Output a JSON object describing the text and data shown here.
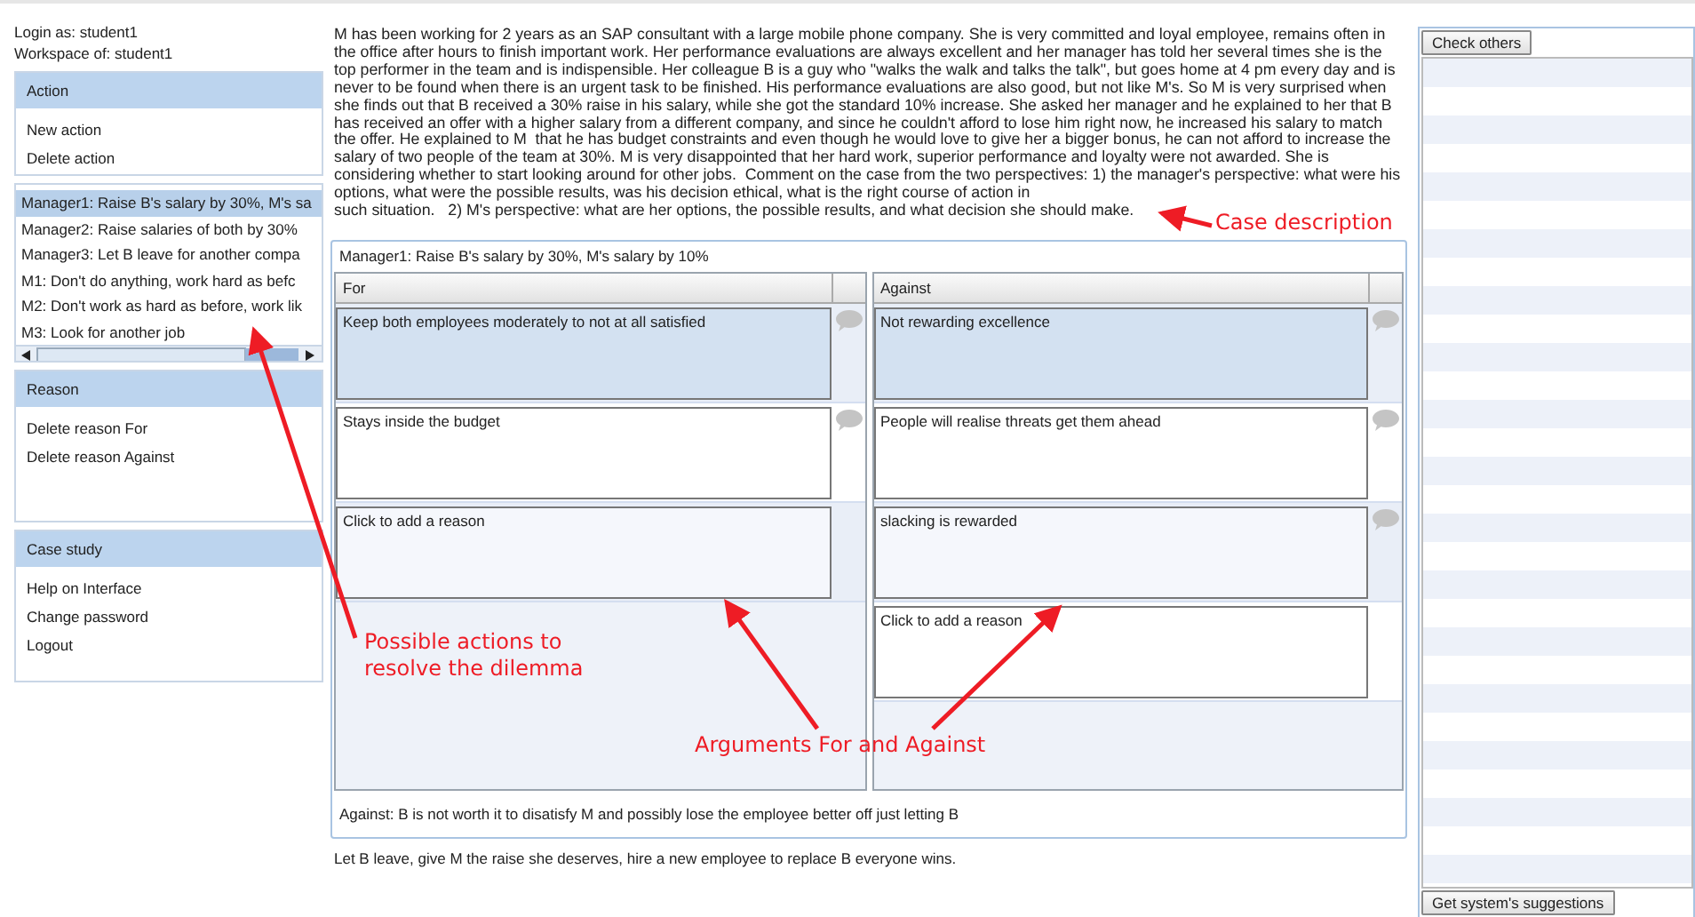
{
  "login": {
    "user_line": "Login as: student1",
    "workspace_line": "Workspace of: student1"
  },
  "panels": [
    {
      "title": "Action",
      "links": [
        "New action",
        "Delete action"
      ]
    },
    {
      "title": "Reason",
      "links": [
        "Delete reason For",
        "Delete reason Against"
      ]
    },
    {
      "title": "Case study",
      "links": [
        "Help on Interface",
        "Change password",
        "Logout"
      ]
    }
  ],
  "actions": [
    {
      "label": "Manager1: Raise B's salary by 30%, M's sa",
      "selected": true
    },
    {
      "label": "Manager2: Raise salaries of both by 30%",
      "selected": false
    },
    {
      "label": "Manager3: Let B leave for another compa",
      "selected": false
    },
    {
      "label": "M1: Don't do anything, work hard as befc",
      "selected": false
    },
    {
      "label": "M2: Don't work as hard as before, work lik",
      "selected": false
    },
    {
      "label": "M3: Look for another job",
      "selected": false
    }
  ],
  "case_description": [
    "M has been working for 2 years as an SAP consultant with a large mobile phone company. She is very committed and loyal employee, remains often in the office after hours to finish important work. Her performance evaluations are always excellent and her manager has told her several times she is the top performer in the team and is indispensible. Her colleague B is a guy who \"walks the walk and talks the talk\", but goes home at 4 pm every day and is never to be found when there is an urgent task to be finished. His performance evaluations are also good, but not like M's. So M is very surprised when she finds out that B received a 30% raise in his salary, while she got the standard 10% increase. She asked her manager and he explained to her that B has received an offer with a higher salary from a different company, and since he couldn't afford to lose him right now, he increased his salary to match the offer. He explained to M  that he has budget constraints and even though he would love to give her a bigger bonus, he can not afford to increase the salary of two people of the team at 30%. M is very disappointed that her hard work, superior performance and loyalty were not awarded. She is considering whether to start looking around for other jobs.  Comment on the case from the two perspectives: 1) the manager's perspective: what were his options, what were the possible results, was his decision ethical, what is the right course of action in",
    "such situation.   2) M's perspective: what are her options, the possible results, and what decision she should make."
  ],
  "action_detail": {
    "title": "Manager1: Raise B's salary by 30%, M's salary by 10%",
    "columns": [
      {
        "heading": "For",
        "reasons": [
          {
            "kind": "reason",
            "text": "Keep both employees moderately to not at all satisfied",
            "selected": true
          },
          {
            "kind": "reason",
            "text": "Stays inside the budget",
            "selected": false
          },
          {
            "kind": "placeholder",
            "text": "Click to add a reason",
            "selected": false
          }
        ]
      },
      {
        "heading": "Against",
        "reasons": [
          {
            "kind": "reason",
            "text": "Not rewarding excellence",
            "selected": true
          },
          {
            "kind": "reason",
            "text": "People will realise threats get them ahead",
            "selected": false
          },
          {
            "kind": "reason",
            "text": "slacking is rewarded",
            "selected": false
          },
          {
            "kind": "placeholder",
            "text": "Click to add a reason",
            "selected": false
          }
        ]
      }
    ],
    "summary": "Against: B is not worth it to disatisfy M and possibly lose the employee better off just letting B"
  },
  "decision": "Let B leave, give M the raise she deserves, hire a new employee to replace B everyone wins.",
  "buttons": {
    "check_others": "Check others",
    "suggestions": "Get system's suggestions"
  },
  "annotations": [
    {
      "kind": "case",
      "text": "Case  description"
    },
    {
      "kind": "actions",
      "text": "Possible actions to resolve the dilemma"
    },
    {
      "kind": "arguments",
      "text": "Arguments For and Against"
    }
  ]
}
